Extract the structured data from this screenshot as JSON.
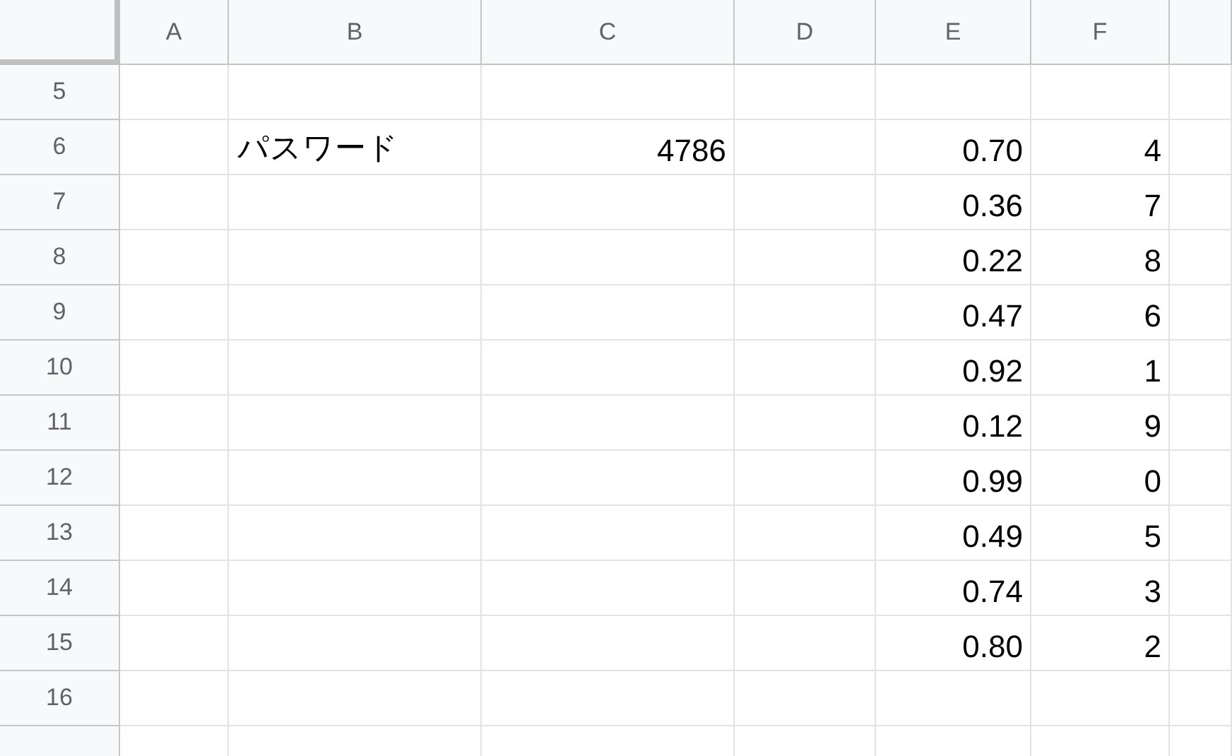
{
  "columns": [
    "A",
    "B",
    "C",
    "D",
    "E",
    "F"
  ],
  "rows": [
    {
      "number": "5",
      "cells": [
        {
          "kind": "empty"
        },
        {
          "kind": "empty"
        },
        {
          "kind": "empty"
        },
        {
          "kind": "empty"
        },
        {
          "kind": "empty"
        },
        {
          "kind": "empty"
        }
      ]
    },
    {
      "number": "6",
      "cells": [
        {
          "kind": "empty"
        },
        {
          "kind": "text",
          "text": "パスワード"
        },
        {
          "kind": "number",
          "text": "4786"
        },
        {
          "kind": "empty"
        },
        {
          "kind": "number",
          "text": "0.70"
        },
        {
          "kind": "number",
          "text": "4"
        }
      ]
    },
    {
      "number": "7",
      "cells": [
        {
          "kind": "empty"
        },
        {
          "kind": "empty"
        },
        {
          "kind": "empty"
        },
        {
          "kind": "empty"
        },
        {
          "kind": "number",
          "text": "0.36"
        },
        {
          "kind": "number",
          "text": "7"
        }
      ]
    },
    {
      "number": "8",
      "cells": [
        {
          "kind": "empty"
        },
        {
          "kind": "empty"
        },
        {
          "kind": "empty"
        },
        {
          "kind": "empty"
        },
        {
          "kind": "number",
          "text": "0.22"
        },
        {
          "kind": "number",
          "text": "8"
        }
      ]
    },
    {
      "number": "9",
      "cells": [
        {
          "kind": "empty"
        },
        {
          "kind": "empty"
        },
        {
          "kind": "empty"
        },
        {
          "kind": "empty"
        },
        {
          "kind": "number",
          "text": "0.47"
        },
        {
          "kind": "number",
          "text": "6"
        }
      ]
    },
    {
      "number": "10",
      "cells": [
        {
          "kind": "empty"
        },
        {
          "kind": "empty"
        },
        {
          "kind": "empty"
        },
        {
          "kind": "empty"
        },
        {
          "kind": "number",
          "text": "0.92"
        },
        {
          "kind": "number",
          "text": "1"
        }
      ]
    },
    {
      "number": "11",
      "cells": [
        {
          "kind": "empty"
        },
        {
          "kind": "empty"
        },
        {
          "kind": "empty"
        },
        {
          "kind": "empty"
        },
        {
          "kind": "number",
          "text": "0.12"
        },
        {
          "kind": "number",
          "text": "9"
        }
      ]
    },
    {
      "number": "12",
      "cells": [
        {
          "kind": "empty"
        },
        {
          "kind": "empty"
        },
        {
          "kind": "empty"
        },
        {
          "kind": "empty"
        },
        {
          "kind": "number",
          "text": "0.99"
        },
        {
          "kind": "number",
          "text": "0"
        }
      ]
    },
    {
      "number": "13",
      "cells": [
        {
          "kind": "empty"
        },
        {
          "kind": "empty"
        },
        {
          "kind": "empty"
        },
        {
          "kind": "empty"
        },
        {
          "kind": "number",
          "text": "0.49"
        },
        {
          "kind": "number",
          "text": "5"
        }
      ]
    },
    {
      "number": "14",
      "cells": [
        {
          "kind": "empty"
        },
        {
          "kind": "empty"
        },
        {
          "kind": "empty"
        },
        {
          "kind": "empty"
        },
        {
          "kind": "number",
          "text": "0.74"
        },
        {
          "kind": "number",
          "text": "3"
        }
      ]
    },
    {
      "number": "15",
      "cells": [
        {
          "kind": "empty"
        },
        {
          "kind": "empty"
        },
        {
          "kind": "empty"
        },
        {
          "kind": "empty"
        },
        {
          "kind": "number",
          "text": "0.80"
        },
        {
          "kind": "number",
          "text": "2"
        }
      ]
    },
    {
      "number": "16",
      "cells": [
        {
          "kind": "empty"
        },
        {
          "kind": "empty"
        },
        {
          "kind": "empty"
        },
        {
          "kind": "empty"
        },
        {
          "kind": "empty"
        },
        {
          "kind": "empty"
        }
      ]
    }
  ]
}
